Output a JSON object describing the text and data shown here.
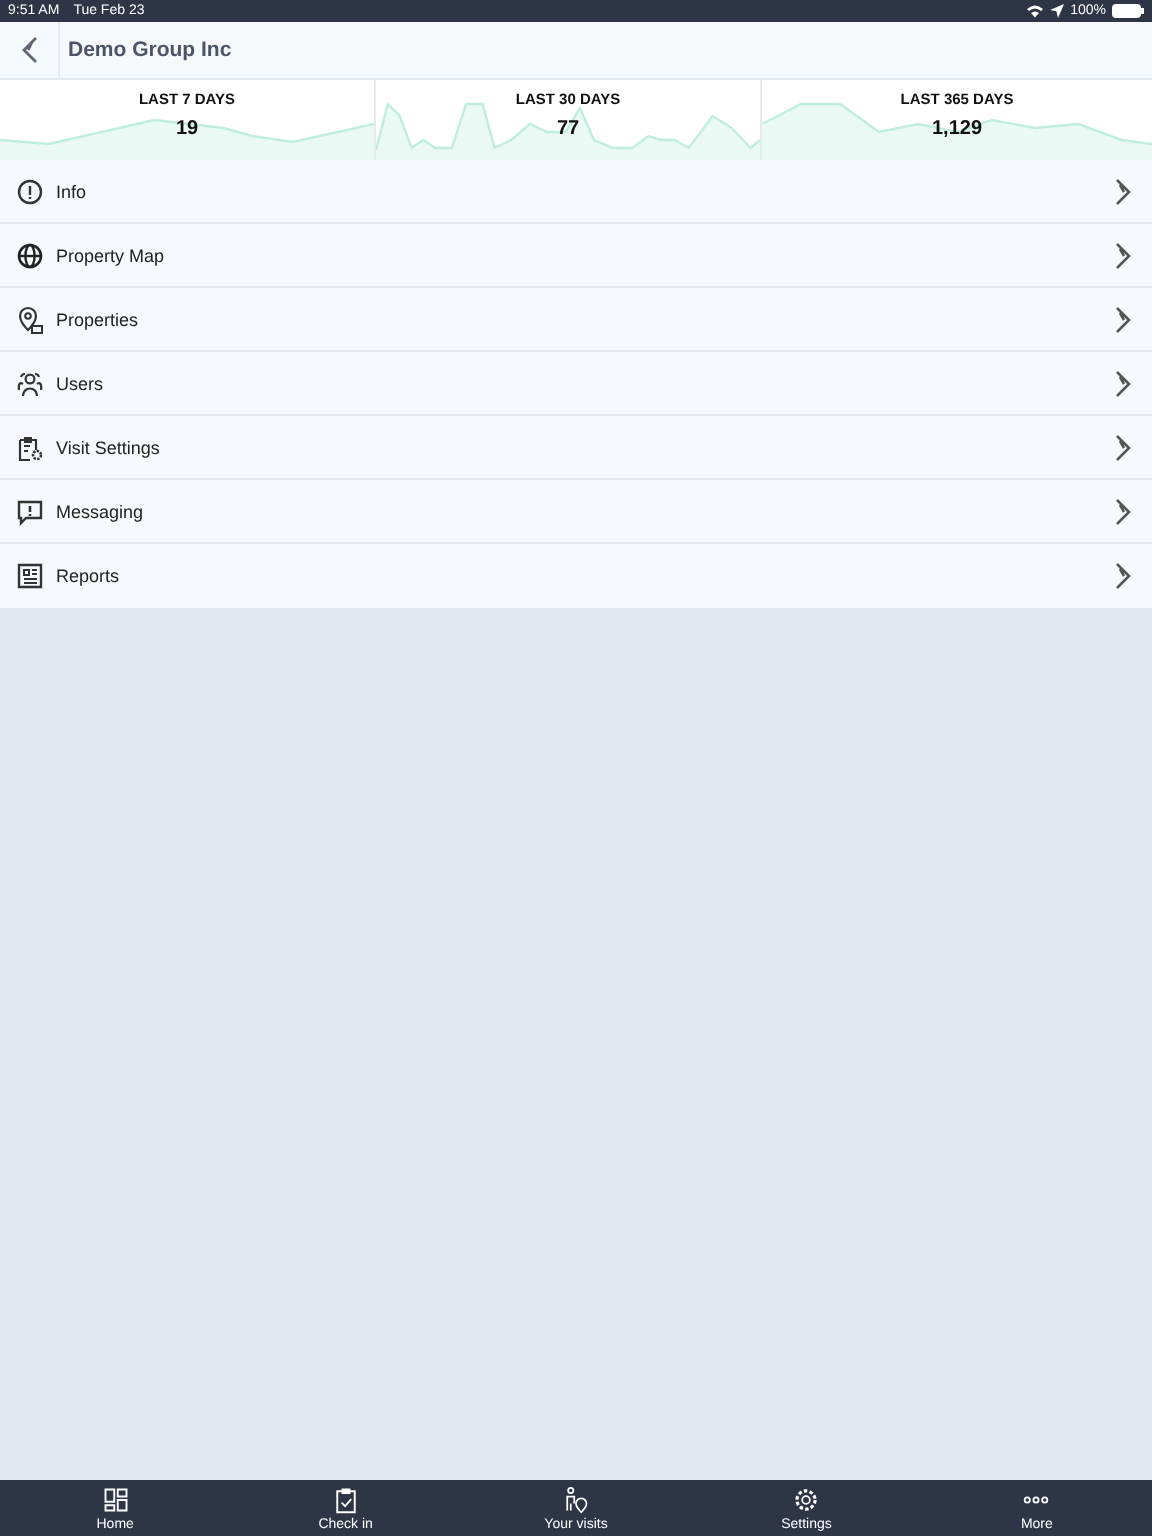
{
  "status_bar": {
    "time": "9:51 AM",
    "date": "Tue Feb 23",
    "battery": "100%"
  },
  "header": {
    "title": "Demo Group Inc"
  },
  "stats": [
    {
      "label": "LAST 7 DAYS",
      "value": "19"
    },
    {
      "label": "LAST 30 DAYS",
      "value": "77"
    },
    {
      "label": "LAST 365 DAYS",
      "value": "1,129"
    }
  ],
  "menu": [
    {
      "label": "Info"
    },
    {
      "label": "Property Map"
    },
    {
      "label": "Properties"
    },
    {
      "label": "Users"
    },
    {
      "label": "Visit Settings"
    },
    {
      "label": "Messaging"
    },
    {
      "label": "Reports"
    }
  ],
  "tab_bar": [
    {
      "label": "Home"
    },
    {
      "label": "Check in"
    },
    {
      "label": "Your visits"
    },
    {
      "label": "Settings"
    },
    {
      "label": "More"
    }
  ]
}
